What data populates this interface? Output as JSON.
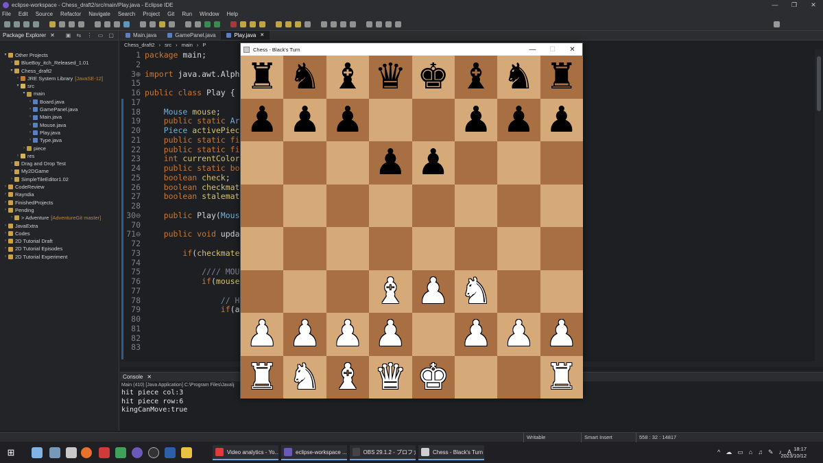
{
  "window": {
    "title": "eclipse-workspace - Chess_draft2/src/main/Play.java - Eclipse IDE",
    "minimize": "—",
    "maximize": "❐",
    "close": "✕"
  },
  "menu": [
    "File",
    "Edit",
    "Source",
    "Refactor",
    "Navigate",
    "Search",
    "Project",
    "Git",
    "Run",
    "Window",
    "Help"
  ],
  "package_explorer": {
    "title": "Package Explorer",
    "items": [
      {
        "indent": 0,
        "arrow": "▾",
        "icon": "proj",
        "label": "Other Projects",
        "deco": ""
      },
      {
        "indent": 1,
        "arrow": "›",
        "icon": "proj",
        "label": "BlueBoy_itch_Released_1.01",
        "deco": ""
      },
      {
        "indent": 1,
        "arrow": "▾",
        "icon": "proj",
        "label": "Chess_draft2",
        "deco": ""
      },
      {
        "indent": 2,
        "arrow": "›",
        "icon": "lib",
        "label": "JRE System Library",
        "deco": "[JavaSE-12]"
      },
      {
        "indent": 2,
        "arrow": "▾",
        "icon": "src",
        "label": "src",
        "deco": ""
      },
      {
        "indent": 3,
        "arrow": "▾",
        "icon": "pkg",
        "label": "main",
        "deco": ""
      },
      {
        "indent": 4,
        "arrow": "›",
        "icon": "java",
        "label": "Board.java",
        "deco": ""
      },
      {
        "indent": 4,
        "arrow": "›",
        "icon": "java",
        "label": "GamePanel.java",
        "deco": ""
      },
      {
        "indent": 4,
        "arrow": "›",
        "icon": "java",
        "label": "Main.java",
        "deco": ""
      },
      {
        "indent": 4,
        "arrow": "›",
        "icon": "java",
        "label": "Mouse.java",
        "deco": ""
      },
      {
        "indent": 4,
        "arrow": "›",
        "icon": "java",
        "label": "Play.java",
        "deco": ""
      },
      {
        "indent": 4,
        "arrow": "›",
        "icon": "java",
        "label": "Type.java",
        "deco": ""
      },
      {
        "indent": 3,
        "arrow": "›",
        "icon": "pkg",
        "label": "piece",
        "deco": ""
      },
      {
        "indent": 2,
        "arrow": "›",
        "icon": "src",
        "label": "res",
        "deco": ""
      },
      {
        "indent": 1,
        "arrow": "›",
        "icon": "proj",
        "label": "Drag and Drop Test",
        "deco": ""
      },
      {
        "indent": 1,
        "arrow": "›",
        "icon": "proj",
        "label": "My2DGame",
        "deco": ""
      },
      {
        "indent": 1,
        "arrow": "›",
        "icon": "proj",
        "label": "SimpleTileEditor1.02",
        "deco": ""
      },
      {
        "indent": 0,
        "arrow": "›",
        "icon": "proj",
        "label": "CodeReview",
        "deco": ""
      },
      {
        "indent": 0,
        "arrow": "›",
        "icon": "proj",
        "label": "Rayndia",
        "deco": ""
      },
      {
        "indent": 0,
        "arrow": "›",
        "icon": "proj",
        "label": "FinishedProjects",
        "deco": ""
      },
      {
        "indent": 0,
        "arrow": "›",
        "icon": "proj",
        "label": "Pending",
        "deco": ""
      },
      {
        "indent": 1,
        "arrow": "›",
        "icon": "proj",
        "label": "> Adventure",
        "deco": "[AdventureGit master]"
      },
      {
        "indent": 0,
        "arrow": "›",
        "icon": "proj",
        "label": "JavaExtra",
        "deco": ""
      },
      {
        "indent": 0,
        "arrow": "›",
        "icon": "proj",
        "label": "Codes",
        "deco": ""
      },
      {
        "indent": 0,
        "arrow": "›",
        "icon": "proj",
        "label": "2D Tutorial Draft",
        "deco": ""
      },
      {
        "indent": 0,
        "arrow": "›",
        "icon": "proj",
        "label": "2D Tutorial Episodes",
        "deco": ""
      },
      {
        "indent": 0,
        "arrow": "›",
        "icon": "proj",
        "label": "2D Tutorial Experiment",
        "deco": ""
      }
    ]
  },
  "editor": {
    "tabs": [
      {
        "label": "Main.java",
        "active": false
      },
      {
        "label": "GamePanel.java",
        "active": false
      },
      {
        "label": "Play.java",
        "active": true
      }
    ],
    "breadcrumb": [
      "Chess_draft2",
      "›",
      "src",
      "›",
      "main",
      "›",
      "P"
    ],
    "lines": [
      {
        "n": "1",
        "segs": [
          [
            "kw",
            "package "
          ],
          [
            "code",
            "main;"
          ]
        ]
      },
      {
        "n": "2",
        "segs": []
      },
      {
        "n": "3⊕",
        "segs": [
          [
            "kw",
            "import "
          ],
          [
            "code",
            "java.awt.Alph"
          ]
        ]
      },
      {
        "n": "15",
        "segs": []
      },
      {
        "n": "16",
        "segs": [
          [
            "kw",
            "public class "
          ],
          [
            "code",
            "Play {"
          ]
        ]
      },
      {
        "n": "17",
        "segs": []
      },
      {
        "n": "18",
        "segs": [
          [
            "code",
            "    "
          ],
          [
            "ty",
            "Mouse "
          ],
          [
            "fld",
            "mouse"
          ],
          [
            "code",
            ";"
          ]
        ]
      },
      {
        "n": "19",
        "segs": [
          [
            "code",
            "    "
          ],
          [
            "kw",
            "public static "
          ],
          [
            "ty",
            "Ar"
          ]
        ]
      },
      {
        "n": "20",
        "segs": [
          [
            "code",
            "    "
          ],
          [
            "ty",
            "Piece "
          ],
          [
            "fld",
            "activePiec"
          ]
        ]
      },
      {
        "n": "21",
        "segs": [
          [
            "code",
            "    "
          ],
          [
            "kw",
            "public static "
          ],
          [
            "kw",
            "fi"
          ]
        ]
      },
      {
        "n": "22",
        "segs": [
          [
            "code",
            "    "
          ],
          [
            "kw",
            "public static "
          ],
          [
            "kw",
            "fi"
          ]
        ]
      },
      {
        "n": "23",
        "segs": [
          [
            "code",
            "    "
          ],
          [
            "kw",
            "int "
          ],
          [
            "fld",
            "currentColor"
          ]
        ]
      },
      {
        "n": "24",
        "segs": [
          [
            "code",
            "    "
          ],
          [
            "kw",
            "public static "
          ],
          [
            "kw",
            "bo"
          ]
        ]
      },
      {
        "n": "25",
        "segs": [
          [
            "code",
            "    "
          ],
          [
            "kw",
            "boolean "
          ],
          [
            "fld",
            "check"
          ],
          [
            "code",
            ";"
          ]
        ]
      },
      {
        "n": "26",
        "segs": [
          [
            "code",
            "    "
          ],
          [
            "kw",
            "boolean "
          ],
          [
            "fld",
            "checkmat"
          ]
        ]
      },
      {
        "n": "27",
        "segs": [
          [
            "code",
            "    "
          ],
          [
            "kw",
            "boolean "
          ],
          [
            "fld",
            "stalemat"
          ]
        ]
      },
      {
        "n": "28",
        "segs": []
      },
      {
        "n": "30⊖",
        "segs": [
          [
            "code",
            "    "
          ],
          [
            "kw",
            "public "
          ],
          [
            "code",
            "Play("
          ],
          [
            "ty",
            "Mous"
          ]
        ]
      },
      {
        "n": "70",
        "segs": []
      },
      {
        "n": "71⊖",
        "segs": [
          [
            "code",
            "    "
          ],
          [
            "kw",
            "public void "
          ],
          [
            "code",
            "upda"
          ]
        ]
      },
      {
        "n": "72",
        "segs": []
      },
      {
        "n": "73",
        "segs": [
          [
            "code",
            "        "
          ],
          [
            "kw",
            "if"
          ],
          [
            "code",
            "("
          ],
          [
            "fld",
            "checkmate"
          ]
        ]
      },
      {
        "n": "74",
        "segs": []
      },
      {
        "n": "75",
        "segs": [
          [
            "code",
            "            "
          ],
          [
            "cm",
            "//// MOU"
          ]
        ]
      },
      {
        "n": "76",
        "segs": [
          [
            "code",
            "            "
          ],
          [
            "kw",
            "if"
          ],
          [
            "code",
            "("
          ],
          [
            "fld",
            "mouse"
          ]
        ]
      },
      {
        "n": "77",
        "segs": []
      },
      {
        "n": "78",
        "segs": [
          [
            "code",
            "                "
          ],
          [
            "cm",
            "// H"
          ]
        ]
      },
      {
        "n": "79",
        "segs": [
          [
            "code",
            "                "
          ],
          [
            "kw",
            "if"
          ],
          [
            "code",
            "(a"
          ]
        ]
      },
      {
        "n": "80",
        "segs": []
      },
      {
        "n": "81",
        "segs": []
      },
      {
        "n": "82",
        "segs": []
      },
      {
        "n": "83",
        "segs": []
      }
    ]
  },
  "console": {
    "title": "Console",
    "launch": "Main (410) [Java Application] C:\\Program Files\\Java\\j",
    "lines": [
      "hit piece col:3",
      "hit piece row:6",
      "kingCanMove:true"
    ]
  },
  "statusbar": {
    "mode": "Writable",
    "insert": "Smart Insert",
    "position": "558 : 32 : 14817"
  },
  "chess_window": {
    "title": "Chess - Black's Turn",
    "minimize": "—",
    "maximize": "☐",
    "close": "✕",
    "board": [
      [
        "bR",
        "bN",
        "bB",
        "bQ",
        "bK",
        "bB",
        "bN",
        "bR"
      ],
      [
        "bP",
        "bP",
        "bP",
        "",
        "",
        "bP",
        "bP",
        "bP"
      ],
      [
        "",
        "",
        "",
        "bP",
        "bP",
        "",
        "",
        ""
      ],
      [
        "",
        "",
        "",
        "",
        "",
        "",
        "",
        ""
      ],
      [
        "",
        "",
        "",
        "",
        "",
        "",
        "",
        ""
      ],
      [
        "",
        "",
        "",
        "wB",
        "wP",
        "wN",
        "",
        ""
      ],
      [
        "wP",
        "wP",
        "wP",
        "wP",
        "",
        "wP",
        "wP",
        "wP"
      ],
      [
        "wR",
        "wN",
        "wB",
        "wQ",
        "wK",
        "",
        "",
        "wR"
      ]
    ],
    "glyphs": {
      "K": "♚",
      "Q": "♛",
      "R": "♜",
      "B": "♝",
      "N": "♞",
      "P": "♟"
    },
    "light_color": "#d6a978",
    "dark_color": "#a87042"
  },
  "taskbar": {
    "apps": [
      {
        "label": "Video analytics - Yo...",
        "color": "#e03a3a"
      },
      {
        "label": "eclipse-workspace ...",
        "color": "#6c58b8"
      },
      {
        "label": "OBS 29.1.2 - プロファ...",
        "color": "#444"
      },
      {
        "label": "Chess - Black's Turn",
        "color": "#cfcfcf"
      }
    ],
    "tray": [
      "^",
      "☁",
      "▭",
      "⌂",
      "♫",
      "✎",
      "♪",
      "A"
    ],
    "time": "18:17",
    "date": "2023/10/12"
  }
}
